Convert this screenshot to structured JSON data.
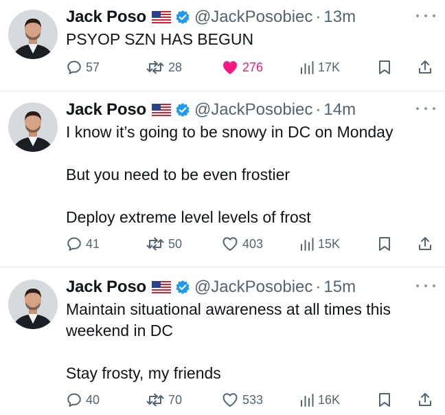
{
  "feed": {
    "tweets": [
      {
        "author_name": "Jack Poso",
        "handle": "@JackPosobiec",
        "separator": "·",
        "time": "13m",
        "paragraphs": [
          "PSYOP SZN HAS BEGUN"
        ],
        "replies": "57",
        "retweets": "28",
        "likes": "276",
        "liked": true,
        "views": "17K"
      },
      {
        "author_name": "Jack Poso",
        "handle": "@JackPosobiec",
        "separator": "·",
        "time": "14m",
        "paragraphs": [
          "I know it’s going to be snowy in DC on Monday",
          "But you need to be even frostier",
          "Deploy extreme level levels of frost"
        ],
        "replies": "41",
        "retweets": "50",
        "likes": "403",
        "liked": false,
        "views": "15K"
      },
      {
        "author_name": "Jack Poso",
        "handle": "@JackPosobiec",
        "separator": "·",
        "time": "15m",
        "paragraphs": [
          "Maintain situational awareness at all times this weekend in DC",
          "Stay frosty, my friends"
        ],
        "replies": "40",
        "retweets": "70",
        "likes": "533",
        "liked": false,
        "views": "16K"
      }
    ]
  },
  "colors": {
    "text": "#0f1419",
    "secondary": "#536471",
    "verified": "#1d9bf0",
    "like": "#f91880",
    "separator": "#e6e9ec"
  },
  "icons": {
    "reply": "speech-bubble-icon",
    "retweet": "retweet-arrows-icon",
    "like": "heart-icon",
    "views": "bar-chart-icon",
    "bookmark": "bookmark-icon",
    "share": "share-arrow-icon",
    "verified": "verified-badge-icon",
    "flag": "us-flag-icon",
    "more": "more-dots-icon"
  }
}
